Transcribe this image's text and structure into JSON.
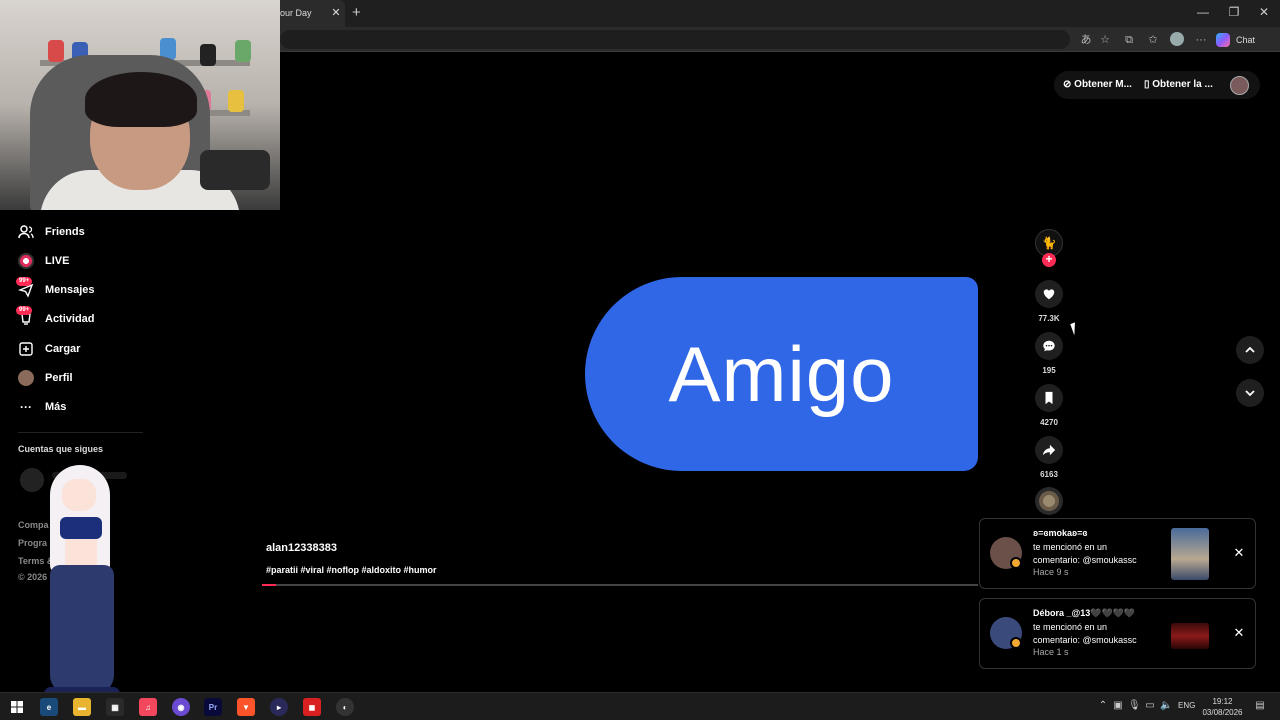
{
  "browser": {
    "tab_title": "our Day",
    "tab_close": "✕",
    "new_tab": "+",
    "chat_label": "Chat",
    "window_controls": {
      "minimize": "—",
      "restore": "❐",
      "close": "✕"
    }
  },
  "sidebar": {
    "items": [
      {
        "label": "Friends",
        "icon": "friends-icon"
      },
      {
        "label": "LIVE",
        "icon": "live-icon"
      },
      {
        "label": "Mensajes",
        "icon": "messages-icon",
        "badge": "99+"
      },
      {
        "label": "Actividad",
        "icon": "activity-icon",
        "badge": "99+"
      },
      {
        "label": "Cargar",
        "icon": "upload-icon"
      },
      {
        "label": "Perfil",
        "icon": "profile-icon"
      },
      {
        "label": "Más",
        "icon": "more-icon"
      }
    ],
    "following_label": "Cuentas que sigues",
    "footer": [
      "Compa",
      "Progra",
      "Terms &",
      "© 2026"
    ]
  },
  "header": {
    "get_coins": "Obtener M...",
    "get_app": "Obtener la ..."
  },
  "video": {
    "word": "Amigo",
    "author": "alan12338383",
    "hashtags": "#paratii #viral #noflop #aldoxito #humor",
    "progress": 0.02
  },
  "actions": {
    "likes": "77.3K",
    "comments": "195",
    "saves": "4270",
    "shares": "6163",
    "follow_plus": "+"
  },
  "notifications": [
    {
      "name": "ʚ=ɞmokaʚ=ɞ",
      "text": "te mencionó en un comentario: @smoukassc",
      "time": "Hace 9 s",
      "close": "✕"
    },
    {
      "name": "Débora _@13🖤🖤🖤🖤",
      "text": "te mencionó en un comentario: @smoukassc",
      "time": "Hace 1 s",
      "close": "✕"
    }
  ],
  "taskbar": {
    "lang": "ENG",
    "time": "19:12",
    "date": "03/08/2026"
  },
  "colors": {
    "accent": "#fe2c55",
    "video_bubble": "#2f67e6",
    "background": "#000000"
  }
}
